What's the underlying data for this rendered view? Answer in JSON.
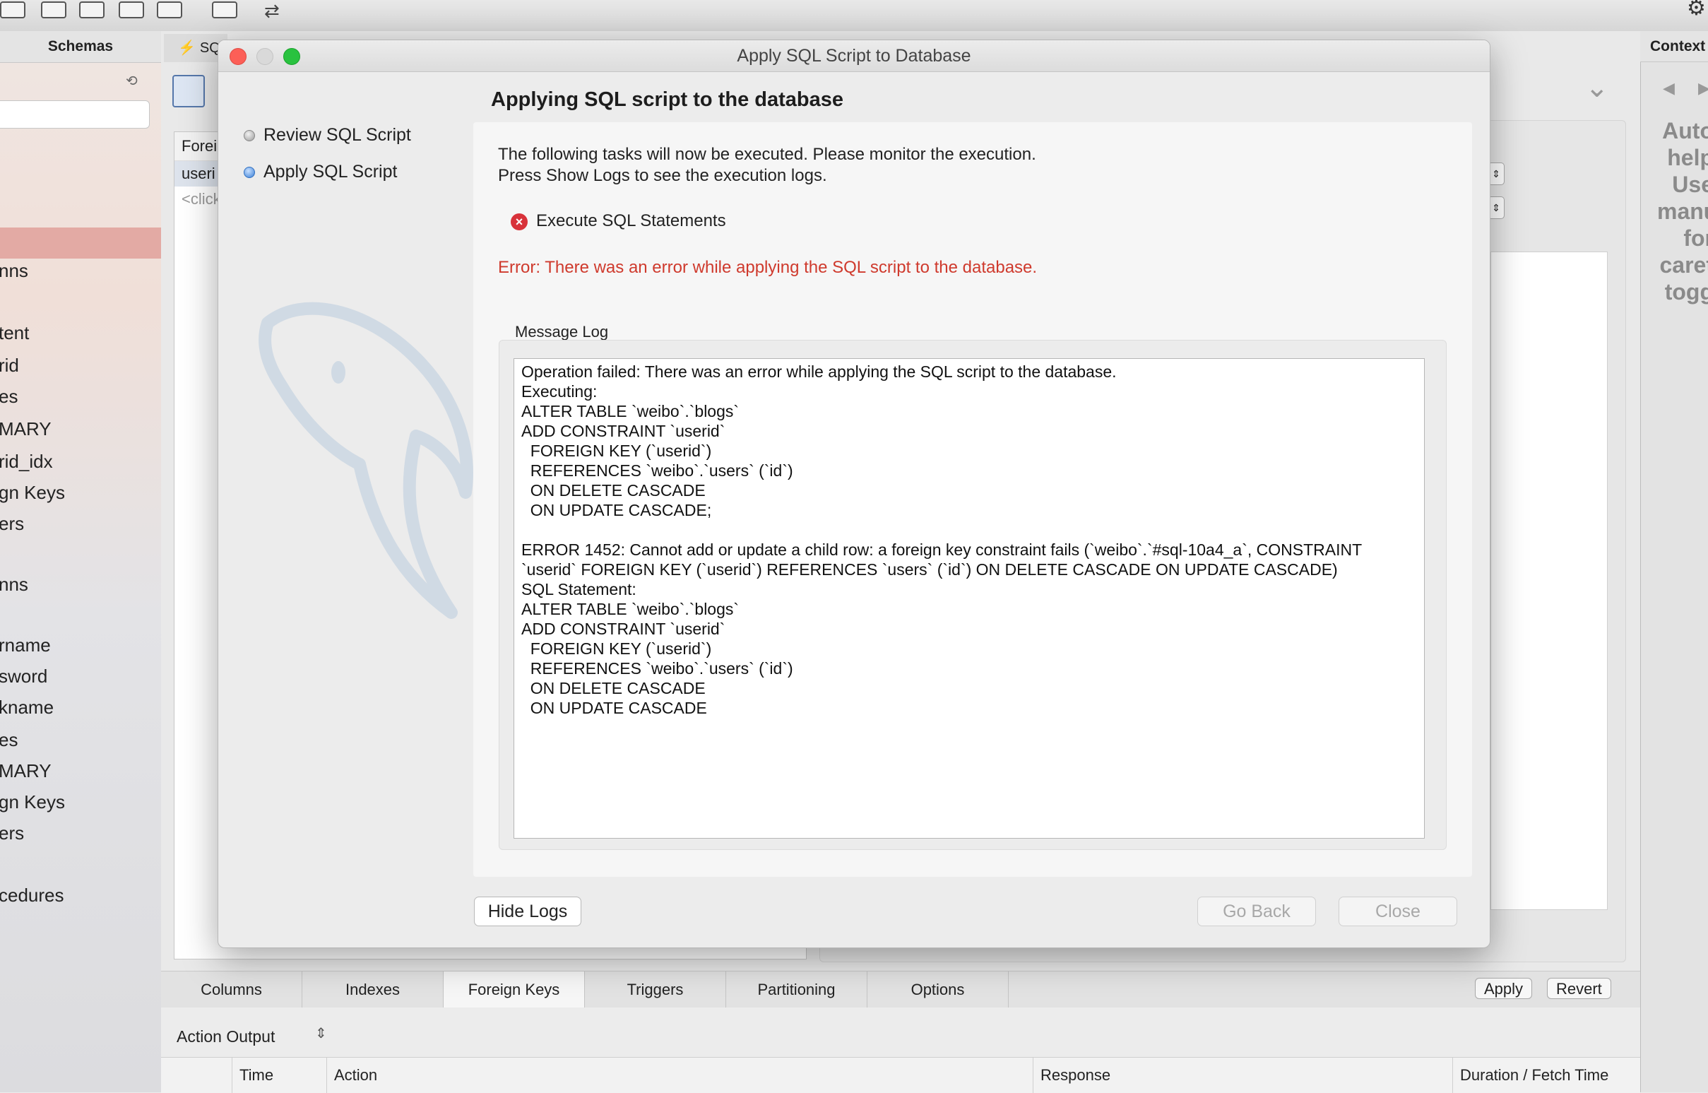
{
  "sidebar": {
    "header": "Schemas",
    "tree_items": [
      "nns",
      "",
      "tent",
      "rid",
      "es",
      "MARY",
      "rid_idx",
      "gn Keys",
      "ers",
      "nns",
      "rname",
      "sword",
      "kname",
      "es",
      "MARY",
      "gn Keys",
      "ers",
      "cedures"
    ]
  },
  "editor": {
    "tab_label": "SQ",
    "list_header": "Forei",
    "list_row": "useri",
    "list_placeholder": "<click"
  },
  "context": {
    "header": "Context",
    "help_lines": [
      "Auto",
      "help",
      "Use",
      "manu",
      "for",
      "caret",
      "togg"
    ]
  },
  "dialog": {
    "title": "Apply SQL Script to Database",
    "heading": "Applying SQL script to the database",
    "steps": [
      "Review SQL Script",
      "Apply SQL Script"
    ],
    "intro_line1": "The following tasks will now be executed. Please monitor the execution.",
    "intro_line2": "Press Show Logs to see the execution logs.",
    "task_label": "Execute SQL Statements",
    "task_icon": "error-x",
    "error_message": "Error: There was an error while applying the SQL script to the database.",
    "log_title": "Message Log",
    "log_lines": [
      "Operation failed: There was an error while applying the SQL script to the database.",
      "Executing:",
      "ALTER TABLE `weibo`.`blogs`",
      "ADD CONSTRAINT `userid`",
      "  FOREIGN KEY (`userid`)",
      "  REFERENCES `weibo`.`users` (`id`)",
      "  ON DELETE CASCADE",
      "  ON UPDATE CASCADE;",
      "",
      "ERROR 1452: Cannot add or update a child row: a foreign key constraint fails (`weibo`.`#sql-10a4_a`, CONSTRAINT",
      "`userid` FOREIGN KEY (`userid`) REFERENCES `users` (`id`) ON DELETE CASCADE ON UPDATE CASCADE)",
      "SQL Statement:",
      "ALTER TABLE `weibo`.`blogs`",
      "ADD CONSTRAINT `userid`",
      "  FOREIGN KEY (`userid`)",
      "  REFERENCES `weibo`.`users` (`id`)",
      "  ON DELETE CASCADE",
      "  ON UPDATE CASCADE"
    ],
    "hide_logs_label": "Hide Logs",
    "go_back_label": "Go Back",
    "close_label": "Close",
    "error_color": "#cf3a2d"
  },
  "bottom_tabs": [
    "Columns",
    "Indexes",
    "Foreign Keys",
    "Triggers",
    "Partitioning",
    "Options"
  ],
  "active_tab": "Foreign Keys",
  "apply_label": "Apply",
  "revert_label": "Revert",
  "action_output": {
    "selector_label": "Action Output",
    "columns": [
      "Time",
      "Action",
      "Response",
      "Duration / Fetch Time"
    ]
  }
}
